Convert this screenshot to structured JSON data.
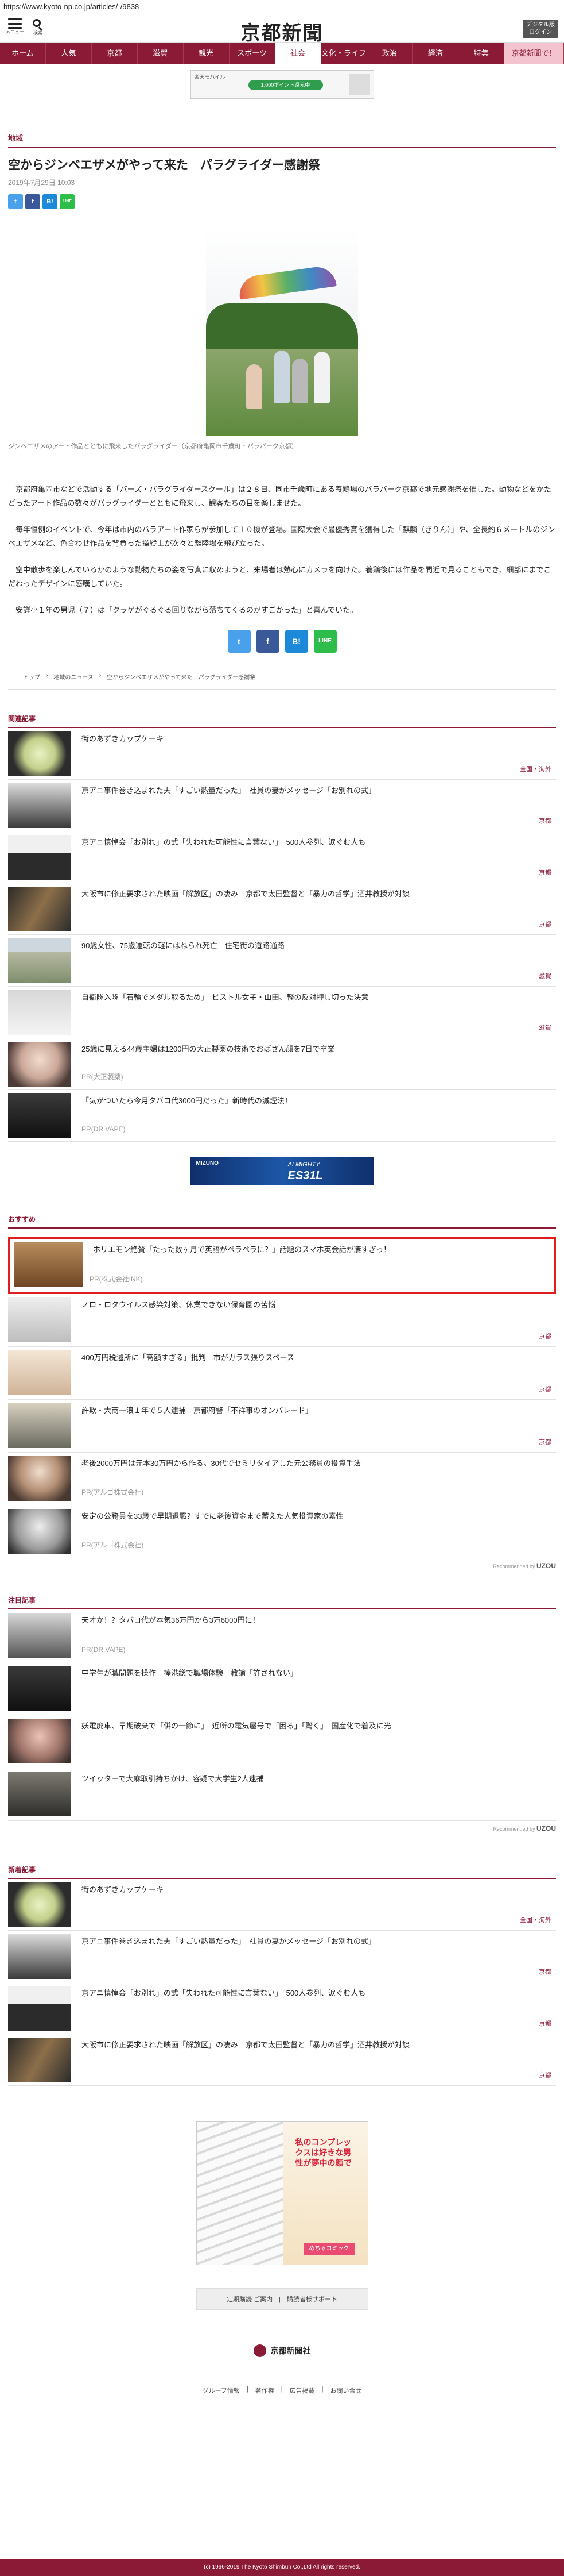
{
  "browser": {
    "url": "https://www.kyoto-np.co.jp/articles/-/9838"
  },
  "masthead": {
    "menu_label": "メニュー",
    "search_label": "検索",
    "logo": "京都新聞",
    "digital_button": "デジタル版 ログイン"
  },
  "nav": [
    "ホーム",
    "人気",
    "京都",
    "滋賀",
    "観光",
    "スポーツ",
    "社会",
    "文化・ライフ",
    "政治",
    "経済",
    "特集",
    "京都新聞で！"
  ],
  "nav_active": "社会",
  "top_ad": {
    "brand": "楽天モバイル",
    "pill": "1,000ポイント還元中"
  },
  "article": {
    "section": "地域",
    "headline": "空からジンベエザメがやって来た　パラグライダー感謝祭",
    "date": "2019年7月29日 10:03",
    "caption": "ジンベエザメのアート作品とともに飛来したパラグライダー（京都府亀岡市千歳町・パラパーク京都）",
    "paragraphs": [
      "京都府亀岡市などで活動する「バーズ・パラグライダースクール」は２８日、同市千歳町にある養鶏場のパラパーク京都で地元感謝祭を催した。動物などをかたどったアート作品の数々がパラグライダーとともに飛来し、観客たちの目を楽しませた。",
      "毎年恒例のイベントで、今年は市内のパラアート作家らが参加して１０機が登場。国際大会で最優秀賞を獲得した「麒麟（きりん）」や、全長約６メートルのジンベエザメなど、色合わせ作品を背負った操縦士が次々と離陸場を飛び立った。",
      "空中散歩を楽しんでいるかのような動物たちの姿を写真に収めようと、来場者は熱心にカメラを向けた。養鶏後には作品を間近で見ることもでき、細部にまでこだわったデザインに感嘆していた。",
      "安詳小１年の男児（７）は「クラゲがぐるぐる回りながら落ちてくるのがすごかった」と喜んでいた。"
    ],
    "share_small": [
      "t",
      "f",
      "B!",
      "LINE"
    ],
    "share_large": [
      "t",
      "f",
      "B!",
      "LINE"
    ]
  },
  "breadcrumb": [
    "トップ",
    "地域のニュース",
    "空からジンベエザメがやって来た　パラグライダー感謝祭"
  ],
  "related": {
    "title": "関連記事",
    "items": [
      {
        "title": "街のあずきカップケーキ",
        "tag": "全国・海外"
      },
      {
        "title": "京アニ事件巻き込まれた夫「すごい熱量だった」　社員の妻がメッセージ「お別れの式」",
        "tag": "京都"
      },
      {
        "title": "京アニ慎悼会「お別れ」の式「失われた可能性に言葉ない」　500人参列、涙ぐむ人も",
        "tag": "京都"
      },
      {
        "title": "大阪市に修正要求された映画「解放区」の凄み　京都で太田監督と「暴力の哲学」酒井教授が対談",
        "tag": "京都"
      },
      {
        "title": "90歳女性、75歳運転の軽にはねられ死亡　住宅街の道路通路",
        "tag": "滋賀"
      },
      {
        "title": "自衛隊入隊「石輪でメダル取るため」　ピストル女子・山田、軽の反対押し切った決意",
        "tag": "滋賀"
      },
      {
        "title": "25歳に見える44歳主婦は1200円の大正製薬の技術でおばさん顔を7日で卒業",
        "pr": "PR(大正製薬)"
      },
      {
        "title": "「気がついたら今月タバコ代3000円だった」新時代の減煙法！",
        "pr": "PR(DR.VAPE)"
      }
    ]
  },
  "mid_ad": {
    "brand": "MIZUNO",
    "line1": "ALMIGHTY",
    "line2": "ES31L"
  },
  "recommend": {
    "title": "おすすめ",
    "items": [
      {
        "title": "ホリエモン絶賛「たった数ヶ月で英語がペラペラに？」話題のスマホ英会話が凄すぎっ！",
        "pr": "PR(株式会社INK)"
      },
      {
        "title": "ノロ・ロタウイルス感染対策、休業できない保育園の苦悩",
        "tag": "京都"
      },
      {
        "title": "400万円税還所に「高額すぎる」批判　市がガラス張りスペース",
        "tag": "京都"
      },
      {
        "title": "許欺・大商一浪１年で５人逮捕　京都府警「不祥事のオンパレード」",
        "tag": "京都"
      },
      {
        "title": "老後2000万円は元本30万円から作る。30代でセミリタイアした元公務員の投資手法",
        "pr": "PR(アルゴ株式会社)"
      },
      {
        "title": "安定の公務員を33歳で早期退職？すでに老後資金まで蓄えた人気投資家の素性",
        "pr": "PR(アルゴ株式会社)"
      }
    ],
    "recommended_by": "Recommended by",
    "recommended_brand": "UZOU"
  },
  "attention": {
    "title": "注目記事",
    "items": [
      {
        "title": "天才か！？タバコ代が本気36万円から3万6000円に！",
        "pr": "PR(DR.VAPE)"
      },
      {
        "title": "中学生が職問題を操作　捧港総で職場体験　教諭「許されない」"
      },
      {
        "title": "妖電廃車、早期破棄で「併の一節に」　近所の電気屋号で「困る」「驚く」　国産化で着及に光"
      },
      {
        "title": "ツイッターで大麻取引持ちかけ、容疑で大学生2人逮捕"
      }
    ],
    "recommended_by": "Recommended by",
    "recommended_brand": "UZOU"
  },
  "latest": {
    "title": "新着記事",
    "items": [
      {
        "title": "街のあずきカップケーキ",
        "tag": "全国・海外"
      },
      {
        "title": "京アニ事件巻き込まれた夫「すごい熱量だった」　社員の妻がメッセージ「お別れの式」",
        "tag": "京都"
      },
      {
        "title": "京アニ慎悼会「お別れ」の式「失われた可能性に言葉ない」　500人参列、涙ぐむ人も",
        "tag": "京都"
      },
      {
        "title": "大阪市に修正要求された映画「解放区」の凄み　京都で太田監督と「暴力の哲学」酒井教授が対談",
        "tag": "京都"
      }
    ]
  },
  "manga_ad": {
    "callout": "私のコンプレックスは好きな男性が夢中の顔で",
    "tag": "めちゃコミック"
  },
  "footer": {
    "subscribe": "定期購読 ご案内　|　購読者様サポート",
    "logo": "京都新聞社",
    "links": [
      "グループ情報",
      "著作権",
      "広告掲載",
      "お問い合せ"
    ],
    "copyright": "(c) 1996-2019 The Kyoto Shimbun Co.,Ltd All rights reserved."
  }
}
